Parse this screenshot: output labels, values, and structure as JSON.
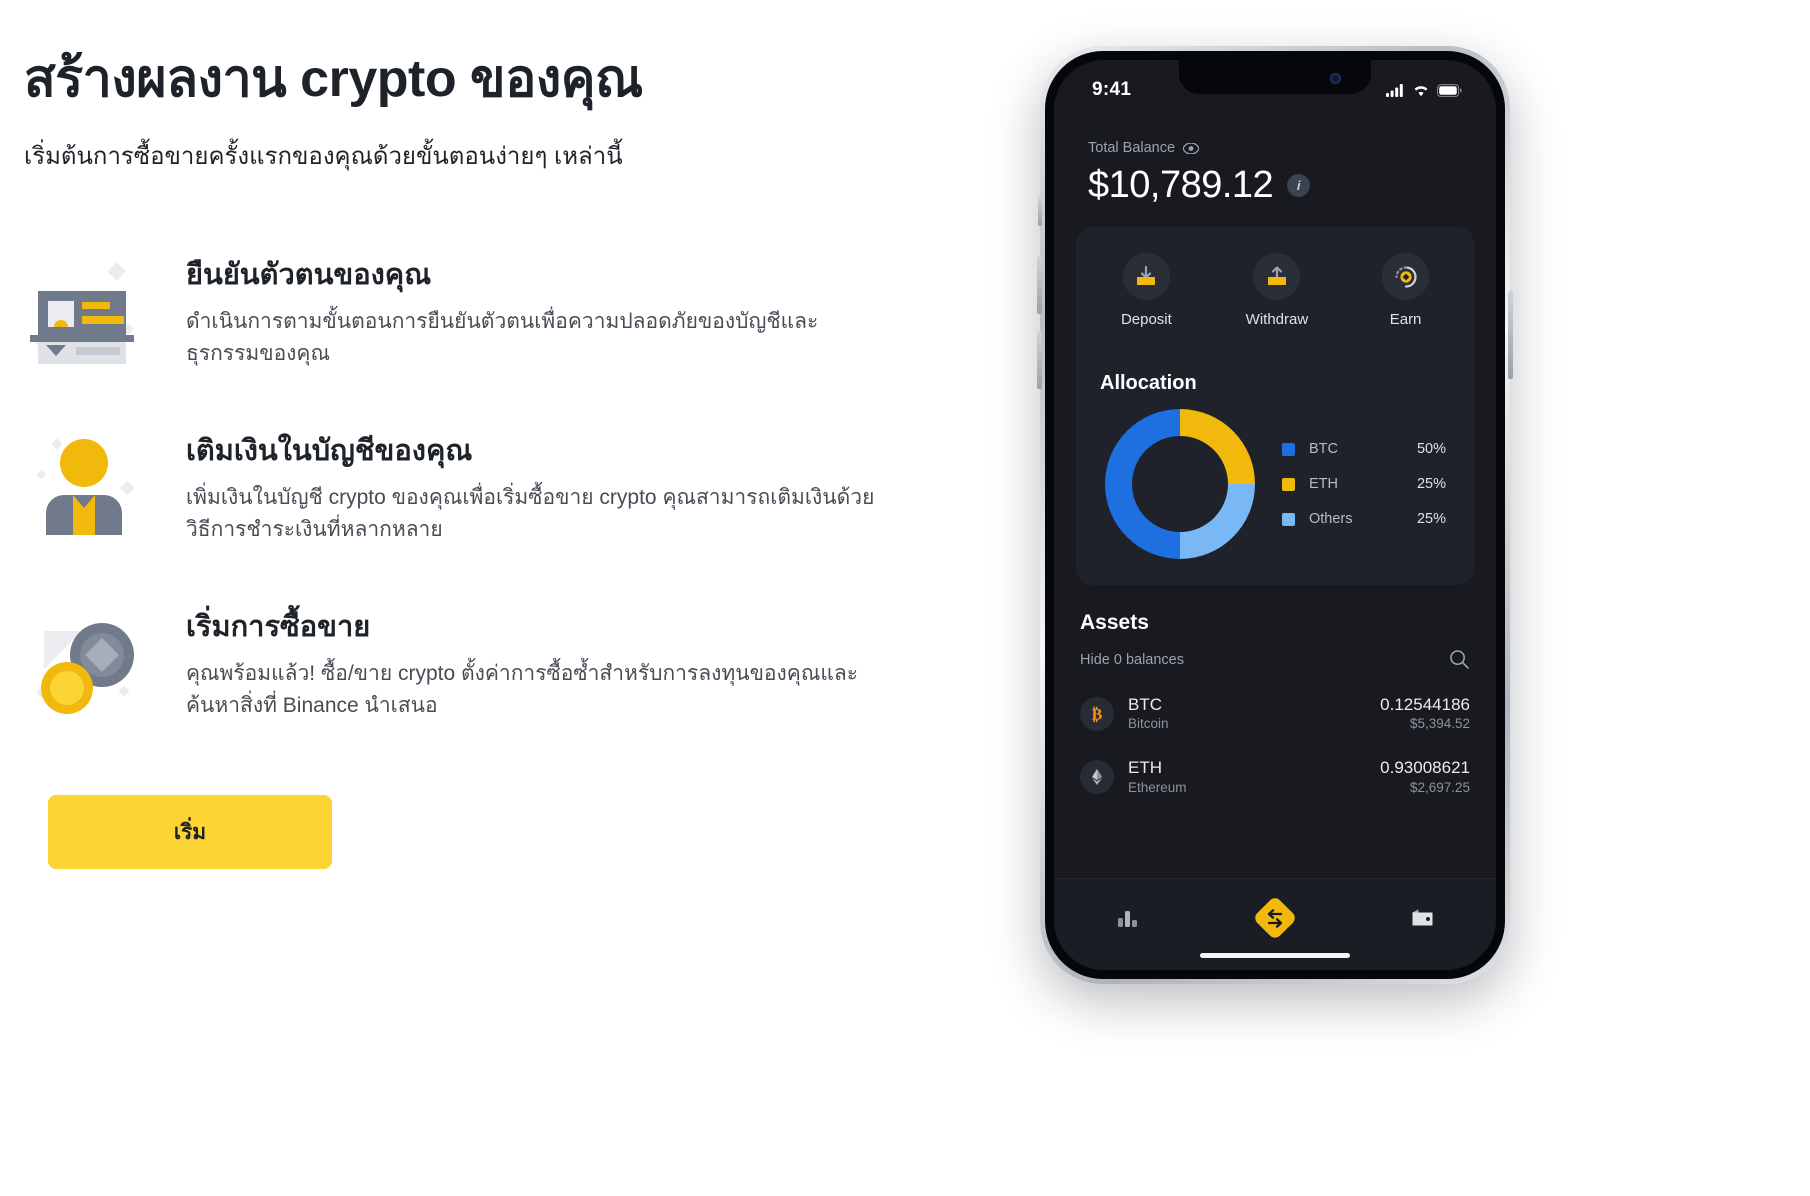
{
  "headline": "สร้างผลงาน crypto ของคุณ",
  "subhead": "เริ่มต้นการซื้อขายครั้งแรกของคุณด้วยขั้นตอนง่ายๆ เหล่านี้",
  "steps": [
    {
      "icon": "id-card-icon",
      "title": "ยืนยันตัวตนของคุณ",
      "desc": "ดำเนินการตามขั้นตอนการยืนยันตัวตนเพื่อความปลอดภัยของบัญชีและธุรกรรมของคุณ"
    },
    {
      "icon": "user-profile-icon",
      "title": "เติมเงินในบัญชีของคุณ",
      "desc": "เพิ่มเงินในบัญชี crypto ของคุณเพื่อเริ่มซื้อขาย crypto คุณสามารถเติมเงินด้วยวิธีการชำระเงินที่หลากหลาย"
    },
    {
      "icon": "coins-icon",
      "title": "เริ่มการซื้อขาย",
      "desc": "คุณพร้อมแล้ว! ซื้อ/ขาย crypto ตั้งค่าการซื้อซ้ำสำหรับการลงทุนของคุณและค้นหาสิ่งที่ Binance นำเสนอ"
    }
  ],
  "cta_label": "เริ่ม",
  "phone": {
    "status": {
      "time": "9:41",
      "icons": [
        "cellular-signal-icon",
        "wifi-icon",
        "battery-icon"
      ]
    },
    "balance": {
      "label": "Total Balance",
      "eye_icon": "eye-icon",
      "amount": "$10,789.12",
      "info_icon": "info-icon"
    },
    "actions": [
      {
        "label": "Deposit",
        "icon": "deposit-icon"
      },
      {
        "label": "Withdraw",
        "icon": "withdraw-icon"
      },
      {
        "label": "Earn",
        "icon": "earn-icon"
      }
    ],
    "allocation": {
      "title": "Allocation",
      "legend": [
        {
          "name": "BTC",
          "pct": "50%",
          "color": "#1E6FE0"
        },
        {
          "name": "ETH",
          "pct": "25%",
          "color": "#F0B90B"
        },
        {
          "name": "Others",
          "pct": "25%",
          "color": "#79B8F5"
        }
      ]
    },
    "assets": {
      "title": "Assets",
      "hide_label": "Hide 0 balances",
      "search_icon": "search-icon",
      "rows": [
        {
          "symbol": "BTC",
          "name": "Bitcoin",
          "amount": "0.12544186",
          "value": "$5,394.52",
          "icon": "bitcoin-icon",
          "color": "#F7931A"
        },
        {
          "symbol": "ETH",
          "name": "Ethereum",
          "amount": "0.93008621",
          "value": "$2,697.25",
          "icon": "ethereum-icon",
          "color": "#8C92A0"
        }
      ]
    },
    "tabs": [
      {
        "icon": "markets-chart-icon",
        "active": false
      },
      {
        "icon": "trade-swap-icon",
        "active": true
      },
      {
        "icon": "wallet-icon",
        "active": false
      }
    ]
  },
  "chart_data": {
    "type": "pie",
    "title": "Allocation",
    "categories": [
      "BTC",
      "ETH",
      "Others"
    ],
    "values": [
      50,
      25,
      25
    ],
    "colors": [
      "#1E6FE0",
      "#F0B90B",
      "#79B8F5"
    ],
    "unit": "%",
    "legend_position": "right",
    "donut": true
  },
  "colors": {
    "brand_yellow": "#FCD535",
    "accent_yellow": "#F0B90B",
    "dark_bg": "#181a20",
    "card_bg": "#1f222a"
  }
}
